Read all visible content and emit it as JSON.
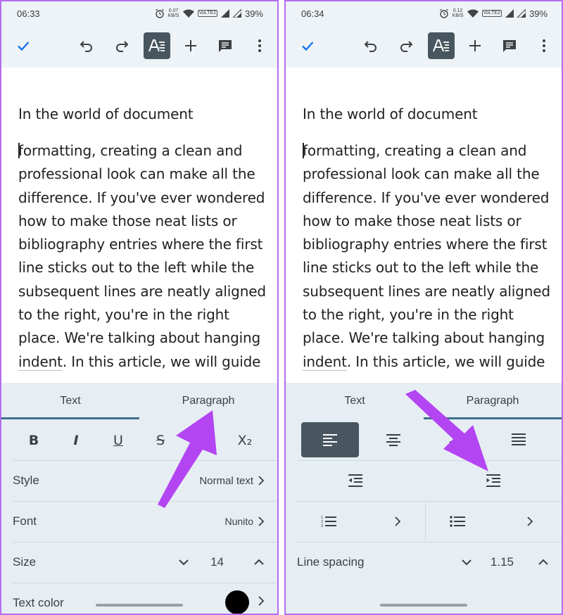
{
  "left": {
    "status": {
      "time": "06:33",
      "net_rate": "0.07",
      "net_unit": "KB/S",
      "badge": "VoLTE2",
      "battery": "39%"
    },
    "document": {
      "first_line": "In the world of document",
      "body_before_indent": "formatting, creating a clean and professional look can make all the difference. If you've ever wondered how to make those neat lists or bibliography entries where the first line sticks out to the left while the subsequent lines are neatly aligned to the right, you're in the right place. We're talking about hanging ",
      "indent_word": "indent",
      "body_after_indent": ". In this article, we will guide"
    },
    "tabs": {
      "text": "Text",
      "paragraph": "Paragraph"
    },
    "format": {
      "bold": "B",
      "italic": "I",
      "underline": "U",
      "strike": "S",
      "subscript": "X₂"
    },
    "rows": {
      "style_label": "Style",
      "style_value": "Normal text",
      "font_label": "Font",
      "font_value": "Nunito",
      "size_label": "Size",
      "size_value": "14",
      "color_label": "Text color"
    }
  },
  "right": {
    "status": {
      "time": "06:34",
      "net_rate": "0.12",
      "net_unit": "KB/S",
      "badge": "VoLTE2",
      "battery": "39%"
    },
    "document": {
      "first_line": "In the world of document",
      "body_before_indent": "formatting, creating a clean and professional look can make all the difference. If you've ever wondered how to make those neat lists or bibliography entries where the first line sticks out to the left while the subsequent lines are neatly aligned to the right, you're in the right place. We're talking about hanging ",
      "indent_word": "indent",
      "body_after_indent": ". In this article, we will guide"
    },
    "tabs": {
      "text": "Text",
      "paragraph": "Paragraph"
    },
    "rows": {
      "line_spacing_label": "Line spacing",
      "line_spacing_value": "1.15"
    }
  },
  "colors": {
    "accent": "#3f6f8f",
    "arrow": "#b445f2",
    "active_btn": "#47565f",
    "panel": "#e6eef3",
    "check": "#1a73e8"
  }
}
